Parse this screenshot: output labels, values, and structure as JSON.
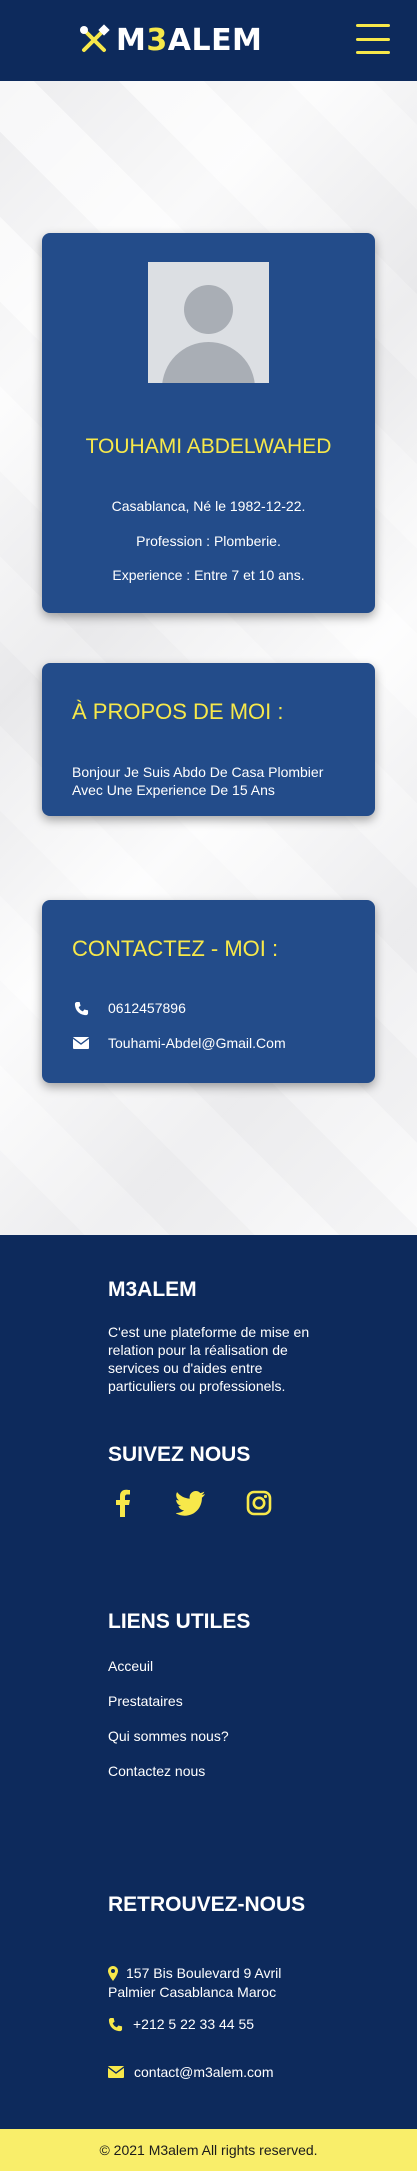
{
  "header": {
    "brand_prefix": "M",
    "brand_highlight": "3",
    "brand_suffix": "ALEM",
    "menu_icon": "hamburger-icon",
    "logo_icon": "tools-icon"
  },
  "colors": {
    "navy": "#0d2a5c",
    "card_blue": "#234c8a",
    "accent_yellow": "#f7e84a",
    "footer_bar": "#f9ee6a"
  },
  "profile": {
    "name": "TOUHAMI ABDELWAHED",
    "location_birth": "Casablanca, Né le 1982-12-22.",
    "profession": "Profession : Plomberie.",
    "experience": "Experience : Entre 7 et 10 ans."
  },
  "about": {
    "title": "À PROPOS DE MOI :",
    "text": "Bonjour Je Suis Abdo De Casa Plombier Avec Une Experience De 15 Ans"
  },
  "contact": {
    "title": "CONTACTEZ - MOI :",
    "phone": "0612457896",
    "email": "Touhami-Abdel@Gmail.Com"
  },
  "footer": {
    "brand_title": "M3ALEM",
    "description": "C'est une plateforme de mise en relation pour la réalisation de services ou d'aides entre particuliers ou professionels.",
    "follow_title": "SUIVEZ NOUS",
    "social": [
      "facebook-icon",
      "twitter-icon",
      "instagram-icon"
    ],
    "links_title": "LIENS UTILES",
    "links": [
      "Acceuil",
      "Prestataires",
      "Qui sommes nous?",
      "Contactez nous"
    ],
    "find_title": "RETROUVEZ-NOUS",
    "address_line1": "157 Bis Boulevard 9 Avril",
    "address_line2": "Palmier Casablanca Maroc",
    "phone": "+212 5 22 33 44 55",
    "email": "contact@m3alem.com"
  },
  "copyright": "© 2021 M3alem All rights reserved."
}
